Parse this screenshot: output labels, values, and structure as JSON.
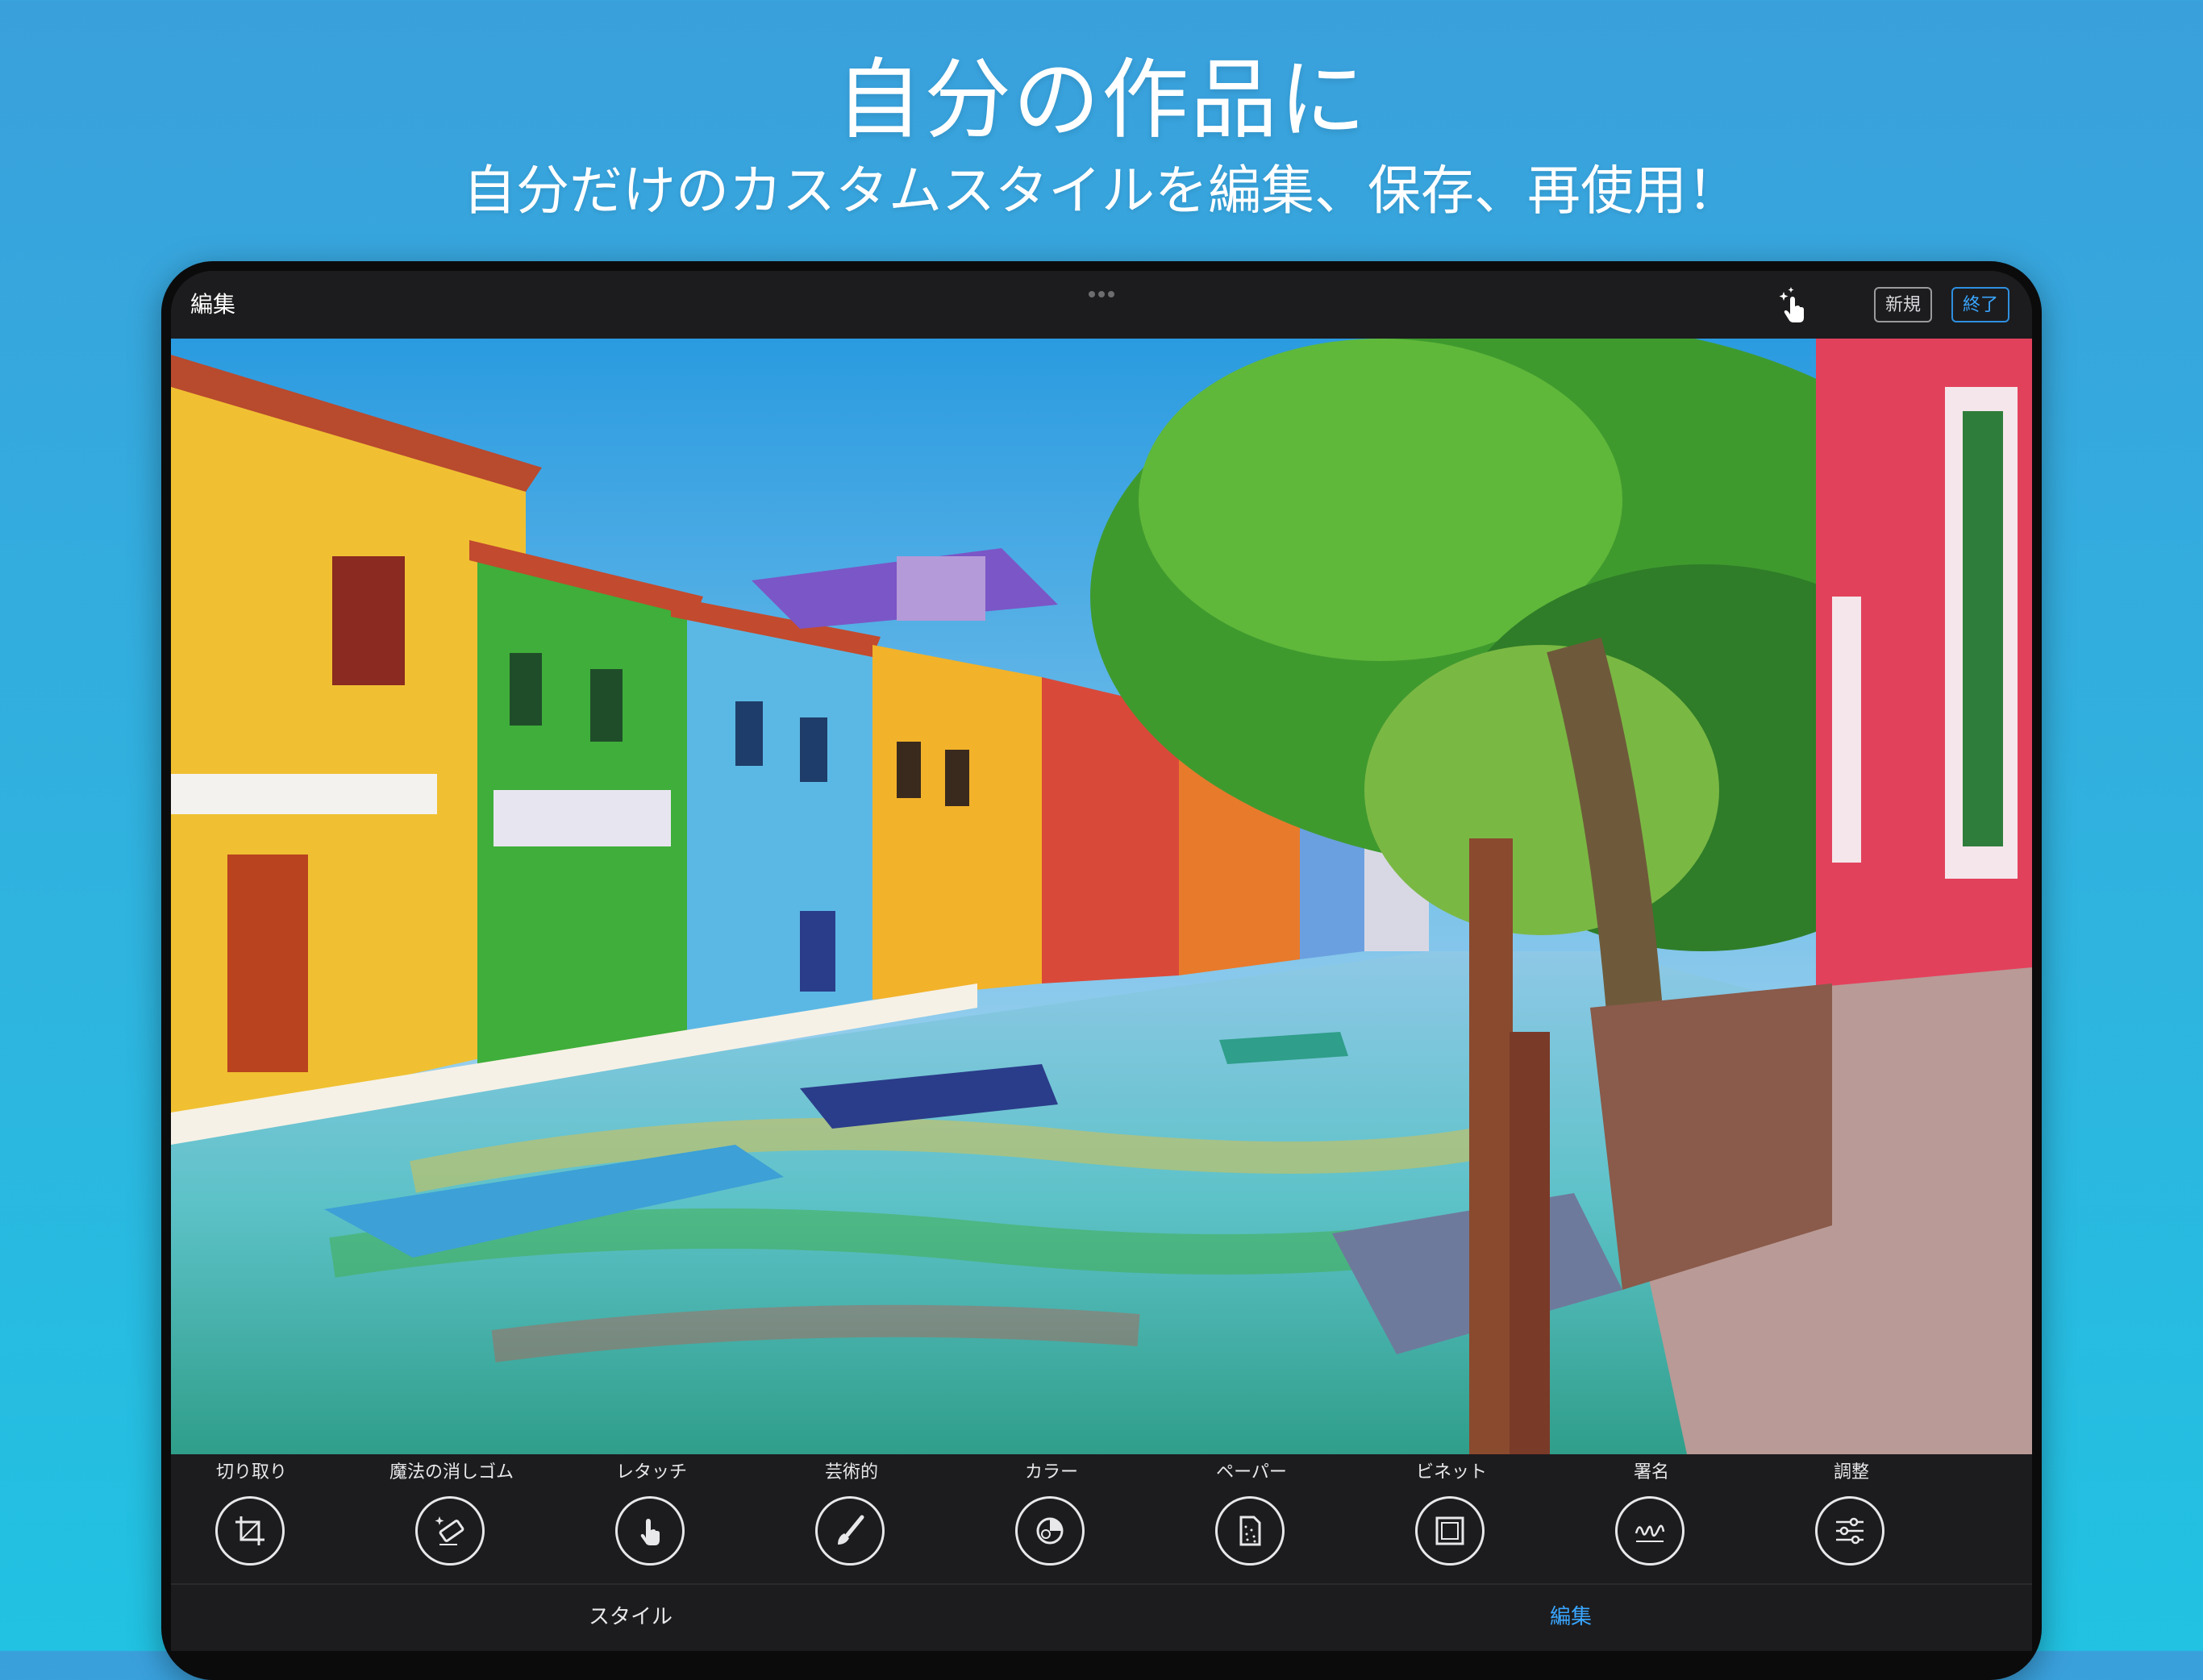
{
  "headline": {
    "title": "自分の作品に",
    "subtitle": "自分だけのカスタムスタイルを編集、保存、再使用！"
  },
  "topbar": {
    "title": "編集",
    "new_label": "新規",
    "done_label": "終了",
    "touch_icon": "hand-tap-sparkle-icon",
    "accent_color": "#3aa6ff"
  },
  "tools": [
    {
      "label": "切り取り",
      "icon": "crop-icon"
    },
    {
      "label": "魔法の消しゴム",
      "icon": "magic-eraser-icon"
    },
    {
      "label": "レタッチ",
      "icon": "touch-finger-icon"
    },
    {
      "label": "芸術的",
      "icon": "paintbrush-icon"
    },
    {
      "label": "カラー",
      "icon": "color-palette-icon"
    },
    {
      "label": "ペーパー",
      "icon": "paper-texture-icon"
    },
    {
      "label": "ビネット",
      "icon": "vignette-frame-icon"
    },
    {
      "label": "署名",
      "icon": "signature-icon"
    },
    {
      "label": "調整",
      "icon": "sliders-icon"
    }
  ],
  "tabs": {
    "style_label": "スタイル",
    "edit_label": "編集",
    "active": "編集"
  }
}
